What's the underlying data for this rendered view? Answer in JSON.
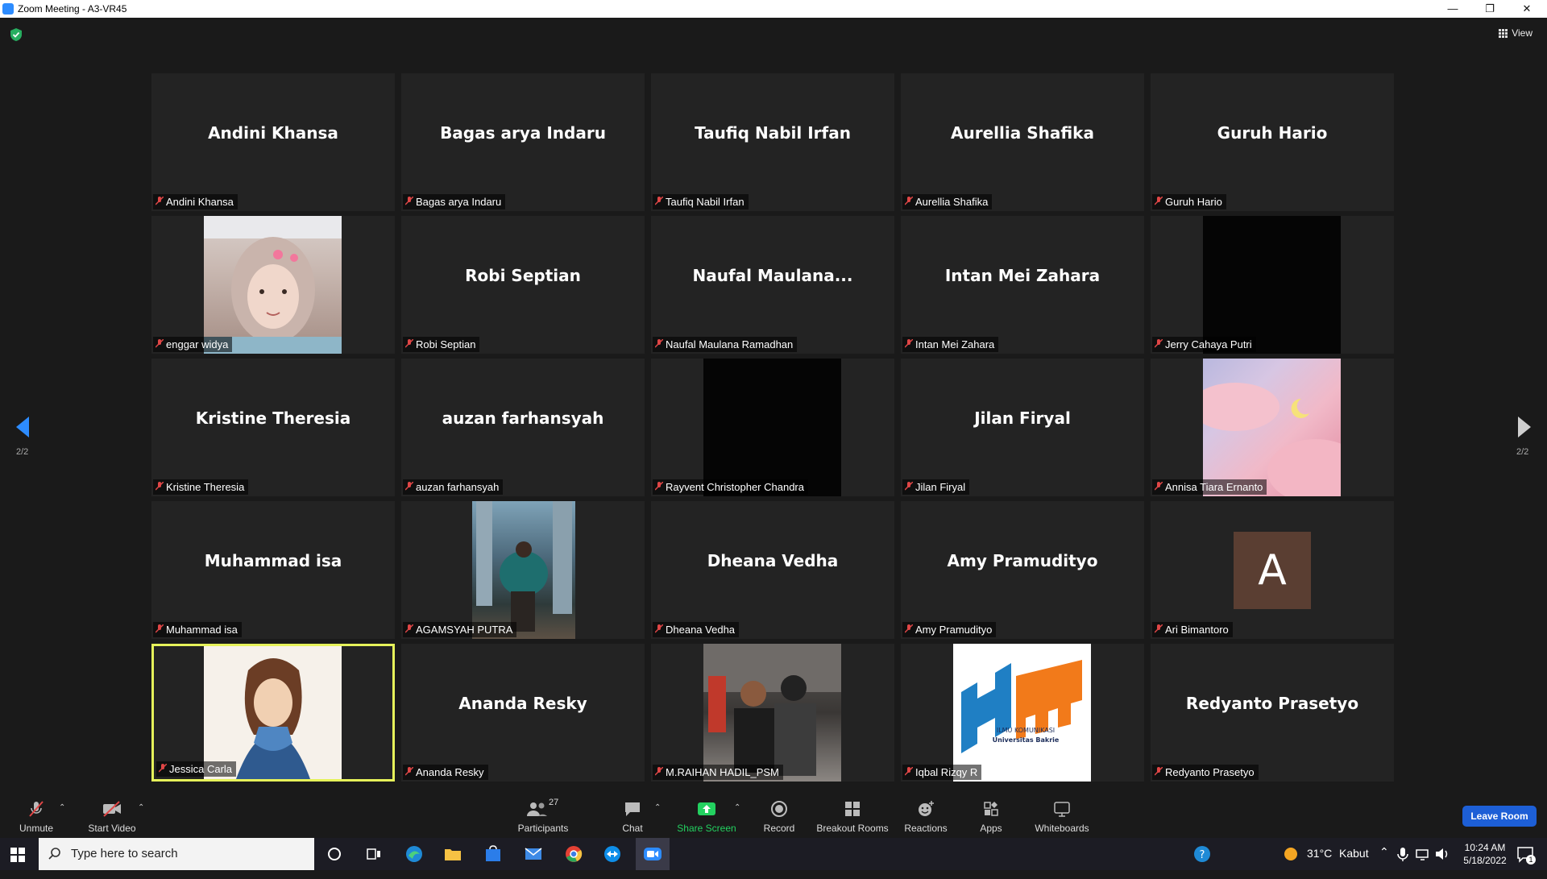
{
  "window": {
    "title": "Zoom Meeting - A3-VR45",
    "minimize_icon": "minimize-icon",
    "restore_icon": "restore-icon",
    "close_icon": "close-icon"
  },
  "topbar": {
    "view_label": "View",
    "security_icon": "shield-check-icon",
    "security_color": "#27ae60"
  },
  "pagination": {
    "left": "2/2",
    "right": "2/2",
    "active_arrow_color": "#2d8cff"
  },
  "tiles": [
    {
      "display_name": "Andini Khansa",
      "label": "Andini Khansa",
      "video": "none"
    },
    {
      "display_name": "Bagas arya Indaru",
      "label": "Bagas arya Indaru",
      "video": "none"
    },
    {
      "display_name": "Taufiq Nabil Irfan",
      "label": "Taufiq Nabil Irfan",
      "video": "none"
    },
    {
      "display_name": "Aurellia Shafika",
      "label": "Aurellia Shafika",
      "video": "none"
    },
    {
      "display_name": "Guruh Hario",
      "label": "Guruh Hario",
      "video": "none"
    },
    {
      "display_name": "",
      "label": "enggar widya",
      "video": "photo"
    },
    {
      "display_name": "Robi Septian",
      "label": "Robi Septian",
      "video": "none"
    },
    {
      "display_name": "Naufal  Maulana...",
      "label": "Naufal Maulana Ramadhan",
      "video": "none"
    },
    {
      "display_name": "Intan Mei Zahara",
      "label": "Intan Mei Zahara",
      "video": "none"
    },
    {
      "display_name": "",
      "label": "Jerry Cahaya Putri",
      "video": "dark"
    },
    {
      "display_name": "Kristine Theresia",
      "label": "Kristine Theresia",
      "video": "none"
    },
    {
      "display_name": "auzan farhansyah",
      "label": "auzan farhansyah",
      "video": "none"
    },
    {
      "display_name": "",
      "label": "Rayvent Christopher Chandra",
      "video": "dark"
    },
    {
      "display_name": "Jilan Firyal",
      "label": "Jilan Firyal",
      "video": "none"
    },
    {
      "display_name": "",
      "label": "Annisa Tiara Ernanto",
      "video": "photo"
    },
    {
      "display_name": "Muhammad isa",
      "label": "Muhammad isa",
      "video": "none"
    },
    {
      "display_name": "",
      "label": "AGAMSYAH PUTRA",
      "video": "photo"
    },
    {
      "display_name": "Dheana Vedha",
      "label": "Dheana Vedha",
      "video": "none"
    },
    {
      "display_name": "Amy Pramudityo",
      "label": "Amy Pramudityo",
      "video": "none"
    },
    {
      "display_name": "",
      "label": "Ari Bimantoro",
      "video": "avatar",
      "avatar_letter": "A"
    },
    {
      "display_name": "",
      "label": "Jessica Carla",
      "video": "photo",
      "active_speaker": true
    },
    {
      "display_name": "Ananda Resky",
      "label": "Ananda Resky",
      "video": "none"
    },
    {
      "display_name": "",
      "label": "M.RAIHAN HADIL_PSM",
      "video": "photo"
    },
    {
      "display_name": "",
      "label": "Iqbal Rizqy R",
      "video": "photo",
      "logo_text_1": "ILMU KOMUNIKASI",
      "logo_text_2": "Universitas Bakrie"
    },
    {
      "display_name": "Redyanto Prasetyo",
      "label": "Redyanto Prasetyo",
      "video": "none"
    }
  ],
  "toolbar": {
    "unmute": "Unmute",
    "start_video": "Start Video",
    "participants": "Participants",
    "participants_count": "27",
    "chat": "Chat",
    "share_screen": "Share Screen",
    "record": "Record",
    "breakout_rooms": "Breakout Rooms",
    "reactions": "Reactions",
    "apps": "Apps",
    "whiteboards": "Whiteboards",
    "leave_room": "Leave Room",
    "share_color": "#23d160",
    "leave_color": "#1d5fd6"
  },
  "taskbar": {
    "search_placeholder": "Type here to search",
    "weather_temp": "31°C",
    "weather_desc": "Kabut",
    "time": "10:24 AM",
    "date": "5/18/2022",
    "notification_count": "1"
  }
}
